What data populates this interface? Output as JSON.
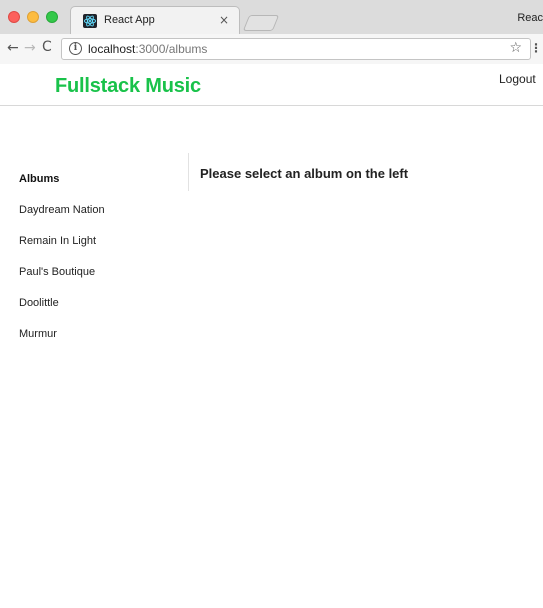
{
  "browser": {
    "tab_title": "React App",
    "tab_close": "×",
    "profile_text": "Reac",
    "url_host": "localhost",
    "url_path": ":3000/albums",
    "info_glyph": "i",
    "back_glyph": "←",
    "forward_glyph": "→",
    "reload_glyph": "C",
    "star_glyph": "☆",
    "menu_glyph": "⋮"
  },
  "header": {
    "brand": "Fullstack Music",
    "logout_label": "Logout",
    "brand_color": "#19c24a"
  },
  "sidebar": {
    "heading": "Albums",
    "items": [
      {
        "label": "Daydream Nation"
      },
      {
        "label": "Remain In Light"
      },
      {
        "label": "Paul's Boutique"
      },
      {
        "label": "Doolittle"
      },
      {
        "label": "Murmur"
      }
    ]
  },
  "main": {
    "placeholder": "Please select an album on the left"
  }
}
